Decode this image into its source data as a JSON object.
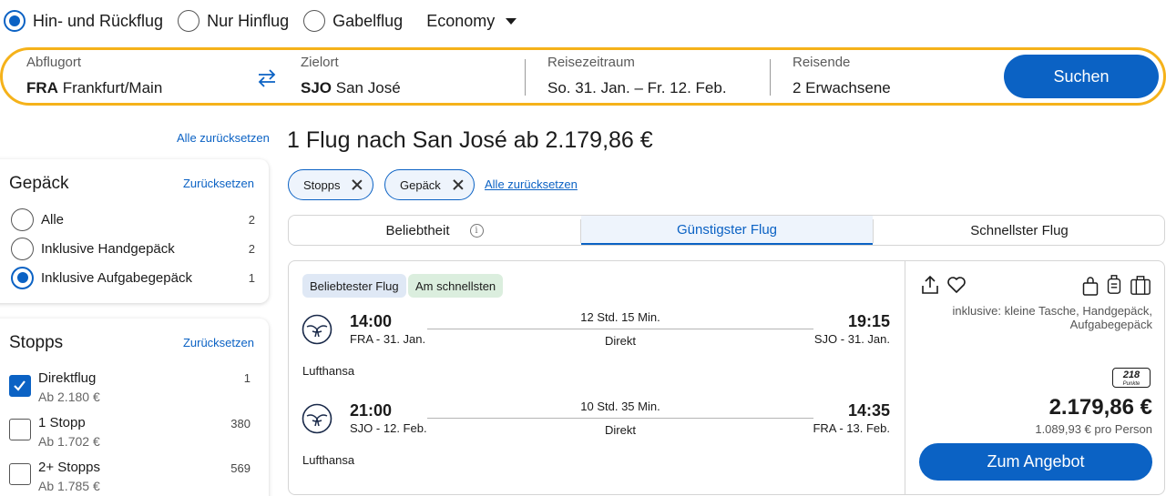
{
  "trip_type": {
    "options": [
      "Hin- und Rückflug",
      "Nur Hinflug",
      "Gabelflug"
    ],
    "selected": "Hin- und Rückflug"
  },
  "cabin": {
    "value": "Economy",
    "icon": "chevron-down-icon"
  },
  "search": {
    "origin": {
      "label": "Abflugort",
      "code": "FRA",
      "city": "Frankfurt/Main"
    },
    "destination": {
      "label": "Zielort",
      "code": "SJO",
      "city": "San José"
    },
    "dates": {
      "label": "Reisezeitraum",
      "value": "So. 31. Jan. – Fr. 12. Feb."
    },
    "travellers": {
      "label": "Reisende",
      "value": "2 Erwachsene"
    },
    "button": "Suchen"
  },
  "sidebar": {
    "reset_all": "Alle zurücksetzen",
    "baggage": {
      "title": "Gepäck",
      "reset": "Zurücksetzen",
      "options": [
        {
          "label": "Alle",
          "count": "2",
          "selected": false
        },
        {
          "label": "Inklusive Handgepäck",
          "count": "2",
          "selected": false
        },
        {
          "label": "Inklusive Aufgabegepäck",
          "count": "1",
          "selected": true
        }
      ]
    },
    "stops": {
      "title": "Stopps",
      "reset": "Zurücksetzen",
      "options": [
        {
          "label": "Direktflug",
          "price": "Ab 2.180 €",
          "count": "1",
          "checked": true
        },
        {
          "label": "1 Stopp",
          "price": "Ab 1.702 €",
          "count": "380",
          "checked": false
        },
        {
          "label": "2+ Stopps",
          "price": "Ab 1.785 €",
          "count": "569",
          "checked": false
        }
      ]
    }
  },
  "results": {
    "title": "1 Flug nach San José ab 2.179,86 €",
    "chips": [
      "Stopps",
      "Gepäck"
    ],
    "chips_reset": "Alle zurücksetzen",
    "sort_tabs": [
      {
        "label": "Beliebtheit",
        "active": false
      },
      {
        "label": "Günstigster Flug",
        "active": true
      },
      {
        "label": "Schnellster Flug",
        "active": false
      }
    ]
  },
  "flight": {
    "tags": [
      "Beliebtester Flug",
      "Am schnellsten"
    ],
    "legs": [
      {
        "dep_time": "14:00",
        "dep_airport": "FRA",
        "dep_date": "31. Jan.",
        "arr_time": "19:15",
        "arr_airport": "SJO",
        "arr_date": "31. Jan.",
        "duration": "12 Std. 15 Min.",
        "stops": "Direkt",
        "airline": "Lufthansa"
      },
      {
        "dep_time": "21:00",
        "dep_airport": "SJO",
        "dep_date": "12. Feb.",
        "arr_time": "14:35",
        "arr_airport": "FRA",
        "arr_date": "13. Feb.",
        "duration": "10 Std. 35 Min.",
        "stops": "Direkt",
        "airline": "Lufthansa"
      }
    ],
    "included": "inklusive: kleine Tasche, Handgepäck, Aufgabegepäck",
    "points": "218",
    "points_unit": "Punkte",
    "price": "2.179,86 €",
    "price_per_person": "1.089,93 € pro Person",
    "offer_button": "Zum Angebot"
  },
  "colors": {
    "accent": "#0b62c4",
    "highlight_border": "#f5b21a"
  }
}
